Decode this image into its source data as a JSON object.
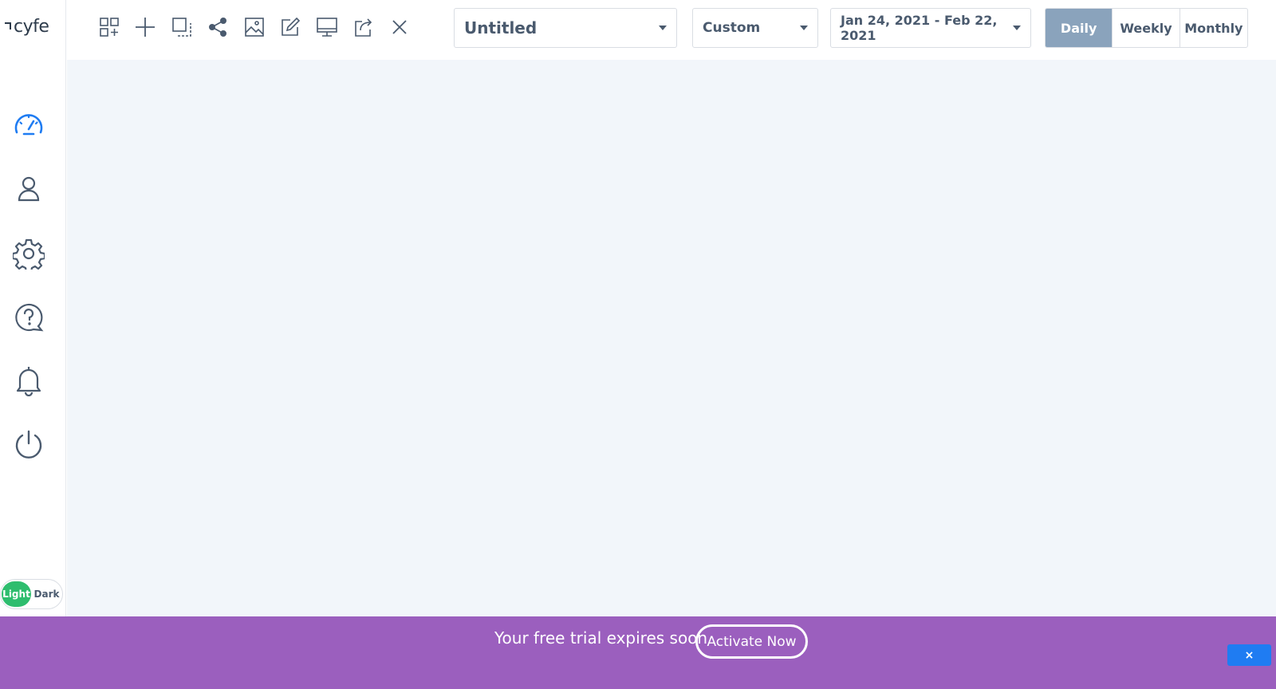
{
  "brand": {
    "name": "cyfe"
  },
  "toolbar": {
    "icons": [
      "add-widget-icon",
      "plus-icon",
      "select-icon",
      "share-icon",
      "image-icon",
      "edit-icon",
      "display-icon",
      "export-icon",
      "close-icon"
    ]
  },
  "dashboard_select": {
    "value": "Untitled"
  },
  "range_select": {
    "value": "Custom"
  },
  "date_range": {
    "value": "Jan 24, 2021 - Feb 22, 2021"
  },
  "period": {
    "options": [
      "Daily",
      "Weekly",
      "Monthly"
    ],
    "selected": "Daily"
  },
  "sidebar": {
    "items": [
      "dashboard-icon",
      "account-icon",
      "settings-icon",
      "help-icon",
      "notifications-icon",
      "logout-icon"
    ],
    "active": "dashboard-icon"
  },
  "theme": {
    "light_label": "Light",
    "dark_label": "Dark",
    "selected": "Light"
  },
  "banner": {
    "message": "Your free trial expires soon",
    "cta_label": "Activate Now",
    "close_label": "×"
  },
  "colors": {
    "accent": "#1f7cf2",
    "icon": "#4a5a6e",
    "active_period": "#8aa3bc",
    "theme_light": "#2ebd6e",
    "banner": "#9b5fbe",
    "canvas": "#f2f6fa"
  }
}
